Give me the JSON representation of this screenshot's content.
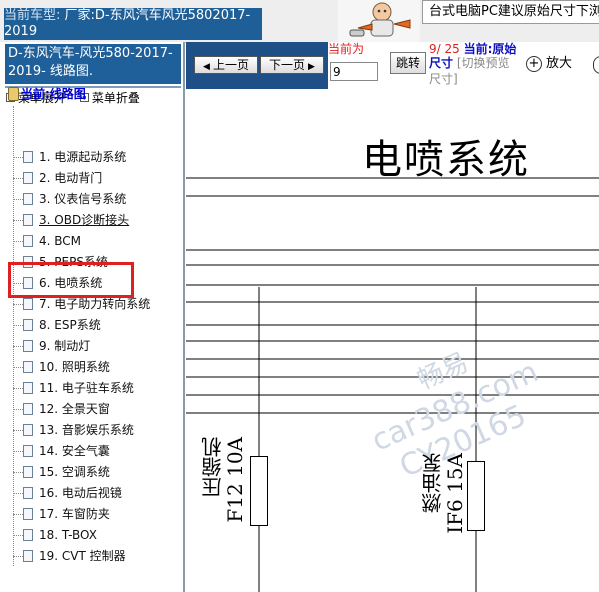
{
  "header": {
    "vehicle_label": "当前车型:",
    "vehicle_value": "厂家:D-东风汽车风光5802017-2019",
    "tip_banner": "台式电脑PC建议原始尺寸下浏览"
  },
  "sidebar": {
    "doc_title": "D-东风汽车-风光580-2017-2019- 线路图.",
    "expand_label": "菜单展开",
    "collapse_label": "菜单折叠",
    "current_root": "当前:线路图",
    "items": [
      {
        "label": "1. 电源起动系统"
      },
      {
        "label": "2. 电动背门"
      },
      {
        "label": "3. 仪表信号系统"
      },
      {
        "label": "3. OBD诊断接头"
      },
      {
        "label": "4. BCM"
      },
      {
        "label": "5. PEPS系统"
      },
      {
        "label": "6. 电喷系统"
      },
      {
        "label": "7. 电子助力转向系统"
      },
      {
        "label": "8. ESP系统"
      },
      {
        "label": "9. 制动灯"
      },
      {
        "label": "10. 照明系统"
      },
      {
        "label": "11. 电子驻车系统"
      },
      {
        "label": "12. 全景天窗"
      },
      {
        "label": "13. 音影娱乐系统"
      },
      {
        "label": "14. 安全气囊"
      },
      {
        "label": "15. 空调系统"
      },
      {
        "label": "16. 电动后视镜"
      },
      {
        "label": "17. 车窗防夹"
      },
      {
        "label": "18. T-BOX"
      },
      {
        "label": "19. CVT 控制器"
      }
    ]
  },
  "toolbar": {
    "prev_label": "上一页",
    "next_label": "下一页",
    "current_label": "当前为",
    "page_input_value": "9",
    "jump_label": "跳转",
    "page_count": "9/ 25",
    "current_mode_label": "当前:",
    "current_mode_value": "原始",
    "size_label": "尺寸",
    "switch_label": "[切换预览",
    "switch_label2": "尺寸]",
    "zoom_label": "放大"
  },
  "document": {
    "heading": "电喷系统",
    "fuse_left_name": "压缩机",
    "fuse_left_code": "F12 10A",
    "fuse_right_name": "燃油泵",
    "fuse_right_code": "IF6 15A",
    "watermark_1": "畅易",
    "watermark_2": "car388.com",
    "watermark_3": "CY20165"
  },
  "colors": {
    "title_blue": "#1e5f98",
    "toolbar_blue": "#1e4f86",
    "selection_red": "#e02020",
    "link_blue": "#0000cc"
  }
}
